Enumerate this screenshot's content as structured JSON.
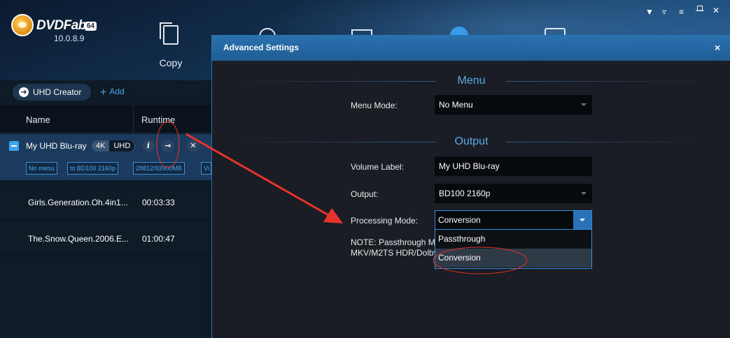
{
  "app": {
    "brand": "DVDFab",
    "bits": "64",
    "version": "10.0.8.9",
    "nav_copy_label": "Copy",
    "window_controls": [
      "shirt-icon",
      "minimize-to-tray-icon",
      "menu-icon",
      "minimize-icon",
      "maximize-icon",
      "close-icon"
    ]
  },
  "left_panel": {
    "creator_label": "UHD Creator",
    "add_label": "Add",
    "columns": {
      "name": "Name",
      "runtime": "Runtime"
    },
    "selected_item": {
      "title": "My UHD Blu-ray",
      "badge_4k": "4K",
      "badge_uhd": "UHD",
      "info_icon": "i",
      "tags": [
        "No menu",
        "to BD100 2160p",
        "28812/93900MB",
        "Vi"
      ]
    },
    "items": [
      {
        "name": "Girls.Generation.Oh.4in1...",
        "runtime": "00:03:33"
      },
      {
        "name": "The.Snow.Queen.2006.E...",
        "runtime": "01:00:47"
      }
    ]
  },
  "dialog": {
    "title": "Advanced Settings",
    "close_glyph": "×",
    "menu_section": "Menu",
    "menu_mode_label": "Menu Mode:",
    "menu_mode_value": "No Menu",
    "output_section": "Output",
    "volume_label_label": "Volume Label:",
    "volume_label_value": "My UHD Blu-ray",
    "output_label": "Output:",
    "output_value": "BD100 2160p",
    "processing_mode_label": "Processing Mode:",
    "processing_mode_value": "Conversion",
    "processing_mode_options": [
      "Passthrough",
      "Conversion"
    ],
    "note_line1": "NOTE: Passthrough M",
    "note_line2": "MKV/M2TS HDR/Dolby"
  },
  "colors": {
    "accent": "#3a8ee0",
    "title_bar": "#2a73b0",
    "annotation": "#e8322c"
  }
}
